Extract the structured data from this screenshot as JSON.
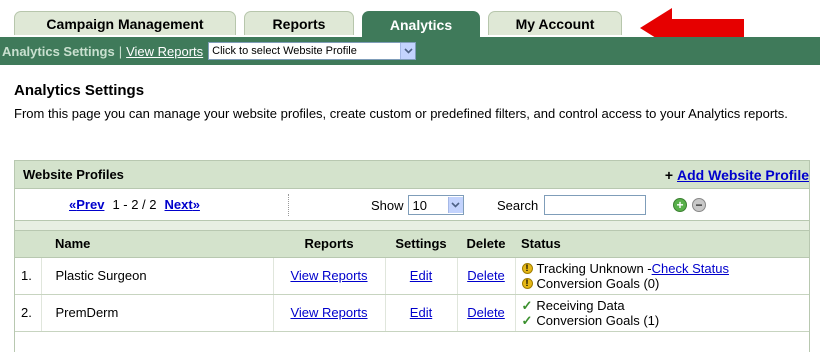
{
  "tabs": [
    {
      "label": "Campaign Management",
      "active": false
    },
    {
      "label": "Reports",
      "active": false
    },
    {
      "label": "Analytics",
      "active": true
    },
    {
      "label": "My Account",
      "active": false
    }
  ],
  "subnav": {
    "current": "Analytics Settings",
    "separator": "|",
    "view_reports": "View Reports",
    "profile_select": "Click to select Website Profile"
  },
  "page": {
    "title": "Analytics Settings",
    "description": "From this page you can manage your website profiles, create custom or predefined filters, and control access to your Analytics reports."
  },
  "panel": {
    "title": "Website Profiles",
    "add_profile": "Add Website Profile",
    "pager": {
      "prev": "Prev",
      "range": "1 - 2 / 2",
      "next": "Next"
    },
    "show_label": "Show",
    "show_value": "10",
    "search_label": "Search",
    "columns": {
      "name": "Name",
      "reports": "Reports",
      "settings": "Settings",
      "delete": "Delete",
      "status": "Status"
    },
    "rows": [
      {
        "num": "1.",
        "name": "Plastic Surgeon",
        "reports": "View Reports",
        "settings": "Edit",
        "delete": "Delete",
        "status1_text": "Tracking Unknown - ",
        "status1_link": "Check Status",
        "status2_text": "Conversion Goals (0)"
      },
      {
        "num": "2.",
        "name": "PremDerm",
        "reports": "View Reports",
        "settings": "Edit",
        "delete": "Delete",
        "status1_text": "Receiving Data",
        "status2_text": "Conversion Goals (1)"
      }
    ]
  },
  "colors": {
    "tab_active": "#3f7a5a",
    "tab_inactive": "#dfe8d6",
    "panel_header": "#d4e3cc",
    "link": "#0000cc",
    "arrow": "#e60000"
  },
  "icons": {
    "arrow": "red-arrow-icon",
    "dropdown": "chevron-down-icon",
    "add_filter": "plus-circle-icon",
    "remove_filter": "minus-circle-icon",
    "warning": "warning-icon",
    "check": "checkmark-icon"
  }
}
